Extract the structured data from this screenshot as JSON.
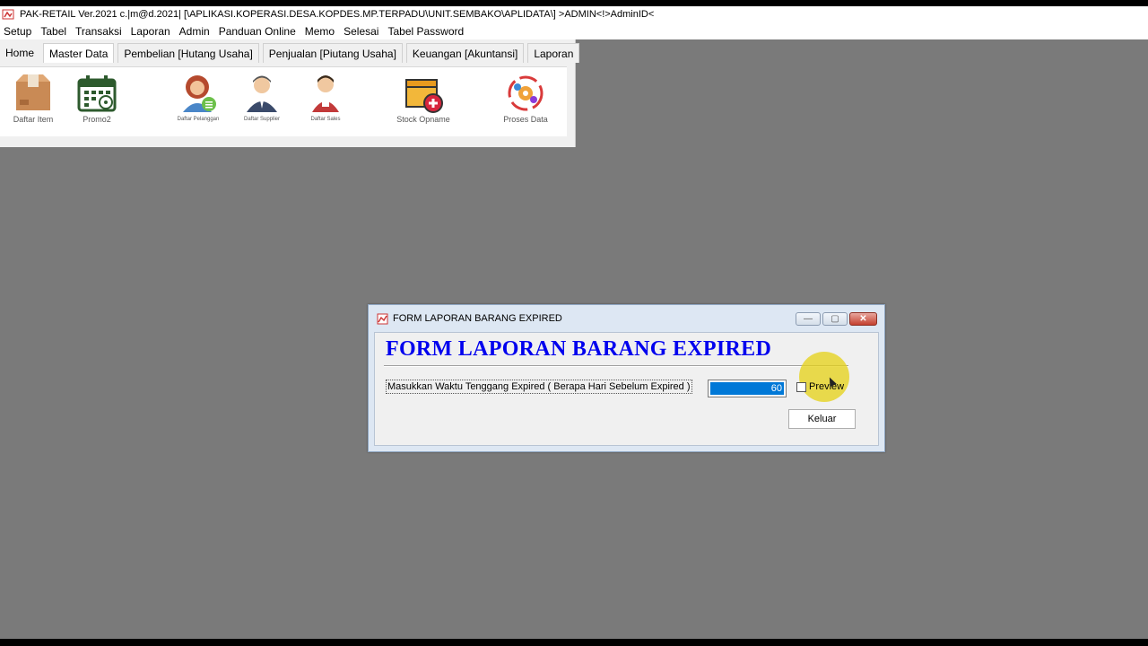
{
  "window": {
    "title": "PAK-RETAIL Ver.2021 c.|m@d.2021| [\\APLIKASI.KOPERASI.DESA.KOPDES.MP.TERPADU\\UNIT.SEMBAKO\\APLIDATA\\] >ADMIN<!>AdminID<"
  },
  "menubar": {
    "items": [
      "Setup",
      "Tabel",
      "Transaksi",
      "Laporan",
      "Admin",
      "Panduan Online",
      "Memo",
      "Selesai",
      "Tabel Password"
    ]
  },
  "ribbon": {
    "tabs": [
      "Home",
      "Master Data",
      "Pembelian [Hutang Usaha]",
      "Penjualan [Piutang Usaha]",
      "Keuangan [Akuntansi]",
      "Laporan"
    ],
    "active_tab": "Master Data",
    "tools": [
      {
        "label": "Daftar Item",
        "icon": "box-icon"
      },
      {
        "label": "Promo2",
        "icon": "calendar-icon"
      },
      {
        "label": "Daftar Pelanggan",
        "icon": "customer-icon"
      },
      {
        "label": "Daftar Supplier",
        "icon": "supplier-icon"
      },
      {
        "label": "Daftar Sales",
        "icon": "sales-icon"
      },
      {
        "label": "Stock Opname",
        "icon": "stock-box-plus-icon"
      },
      {
        "label": "Proses Data",
        "icon": "process-gear-icon"
      }
    ]
  },
  "dialog": {
    "title": "FORM LAPORAN BARANG EXPIRED",
    "heading": "FORM LAPORAN BARANG EXPIRED",
    "prompt": "Masukkan Waktu Tenggang Expired ( Berapa Hari Sebelum Expired )",
    "days_value": "60",
    "preview_label": "Preview",
    "preview_checked": false,
    "keluar_label": "Keluar",
    "minimize_glyph": "—",
    "maximize_glyph": "▢",
    "close_glyph": "✕"
  },
  "colors": {
    "desktop": "#7a7a7a",
    "heading": "#0000ee",
    "selection": "#0078d7",
    "cursor_highlight": "#e6d214"
  }
}
